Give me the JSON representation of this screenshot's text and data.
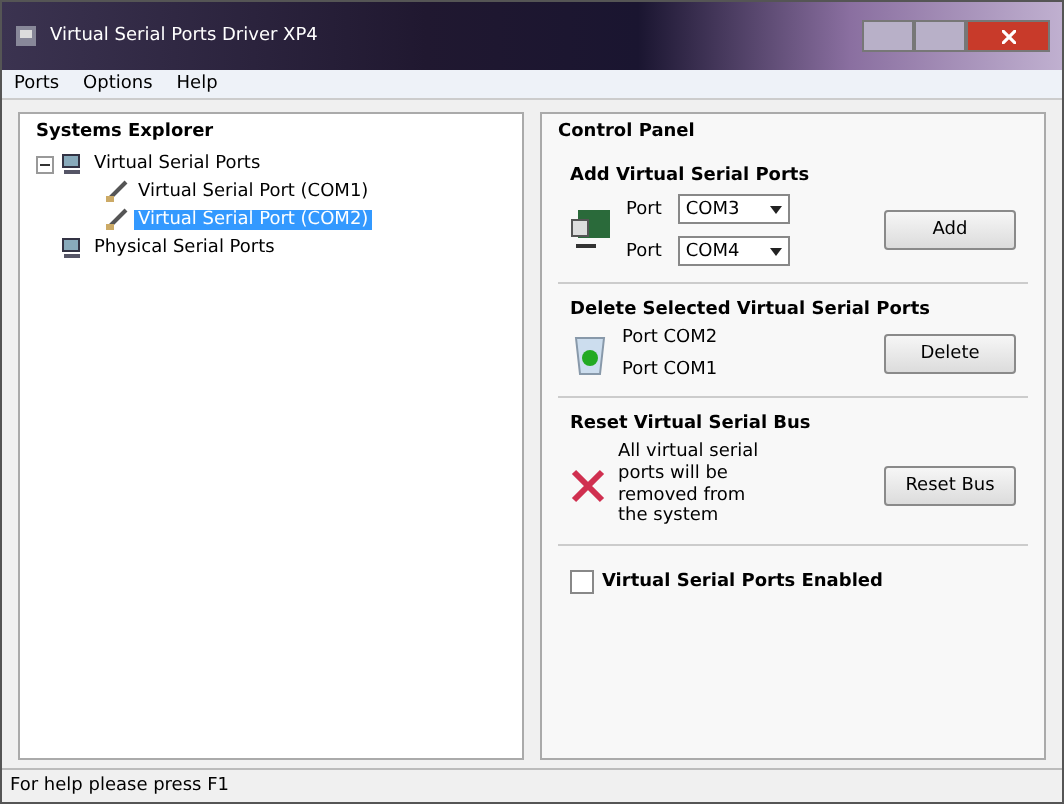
{
  "window": {
    "title": "Virtual Serial Ports Driver XP4"
  },
  "menu": [
    "Ports",
    "Options",
    "Help"
  ],
  "explorer": {
    "title": "Systems Explorer",
    "tree": [
      {
        "label": "Virtual Serial Ports",
        "expanded": true,
        "selected": false,
        "kind": "computer",
        "children": [
          {
            "label": "Virtual Serial Port (COM1)",
            "selected": false,
            "kind": "port"
          },
          {
            "label": "Virtual Serial Port (COM2)",
            "selected": true,
            "kind": "port"
          }
        ]
      },
      {
        "label": "Physical Serial Ports",
        "selected": false,
        "kind": "computer"
      }
    ]
  },
  "control_panel": {
    "title": "Control Panel",
    "add": {
      "title": "Add Virtual Serial Ports",
      "ports": [
        {
          "label": "Port",
          "value": "COM3"
        },
        {
          "label": "Port",
          "value": "COM4"
        }
      ],
      "button": "Add"
    },
    "delete": {
      "title": "Delete Selected Virtual Serial Ports",
      "ports": [
        "Port COM2",
        "Port COM1"
      ],
      "button": "Delete"
    },
    "reset": {
      "title": "Reset Virtual Serial Bus",
      "text": "All virtual serial ports will be removed from the system",
      "button": "Reset Bus"
    },
    "enabled": {
      "label": "Virtual Serial Ports Enabled",
      "checked": false
    }
  },
  "status_bar": "For help please press F1"
}
